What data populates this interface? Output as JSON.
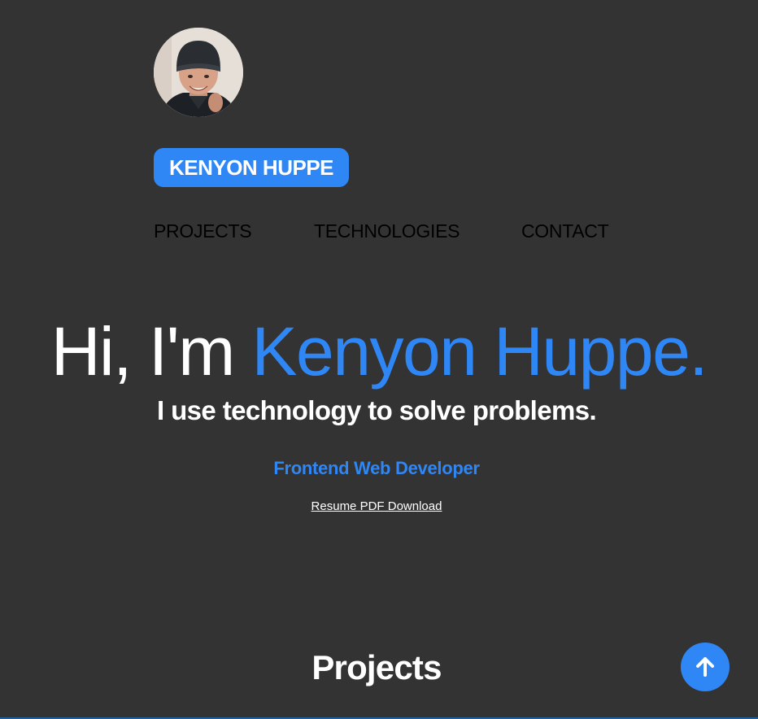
{
  "header": {
    "avatar_alt": "Kenyon Huppe profile photo",
    "name_badge": "KENYON HUPPE"
  },
  "nav": {
    "items": [
      {
        "label": "PROJECTS"
      },
      {
        "label": "TECHNOLOGIES"
      },
      {
        "label": "CONTACT"
      }
    ]
  },
  "hero": {
    "greeting": "Hi, I'm ",
    "name": "Kenyon Huppe.",
    "tagline": "I use technology to solve problems.",
    "role": "Frontend Web Developer",
    "resume_link": "Resume PDF Download"
  },
  "projects": {
    "title": "Projects"
  },
  "scroll_top": {
    "icon": "arrow-up-icon"
  },
  "colors": {
    "background": "#333333",
    "accent": "#2f86f5",
    "text": "#ffffff",
    "nav_text": "#000000"
  }
}
